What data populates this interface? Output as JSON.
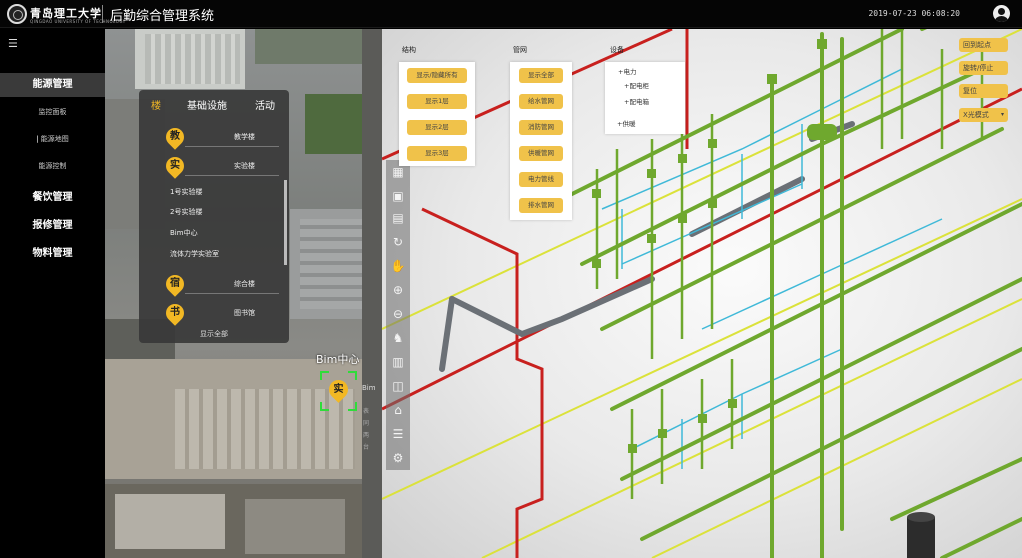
{
  "header": {
    "university_name": "青岛理工大学",
    "university_sub": "QINGDAO UNIVERSITY OF TECHNOLOGY",
    "app_title": "后勤综合管理系统",
    "datetime": "2019-07-23 06:08:20"
  },
  "sidebar": {
    "toggle_icon": "☰",
    "groups": [
      {
        "label": "能源管理",
        "active": true
      },
      {
        "label": "餐饮管理"
      },
      {
        "label": "报修管理"
      },
      {
        "label": "物料管理"
      }
    ],
    "energy_subitems": [
      "监控面板",
      "能源地图",
      "能源控制"
    ]
  },
  "map_panel": {
    "tabs": [
      "楼",
      "基础设施",
      "活动"
    ],
    "categories": [
      {
        "icon": "教",
        "label": "教学楼"
      },
      {
        "icon": "实",
        "label": "实验楼"
      },
      {
        "icon": "宿",
        "label": "综合楼"
      },
      {
        "icon": "书",
        "label": "图书馆"
      }
    ],
    "lab_items": [
      "1号实验楼",
      "2号实验楼",
      "Bim中心",
      "流体力学实验室"
    ],
    "show_all": "显示全部",
    "marker_label": "Bim中心",
    "marker_icon": "实",
    "marker_side": "Bim",
    "marker_side_lines": [
      "表",
      "同",
      "两",
      "台"
    ]
  },
  "viewer": {
    "structure": {
      "title": "结构",
      "buttons": [
        "显示/隐藏所有",
        "显示1层",
        "显示2层",
        "显示3层"
      ]
    },
    "pipes": {
      "title": "管网",
      "buttons": [
        "显示全部",
        "给水管网",
        "消防管网",
        "供暖管网",
        "电力管线",
        "排水管网"
      ]
    },
    "equipment": {
      "title": "设备",
      "tree": [
        "+电力",
        "+配电柜",
        "+配电箱",
        "+供暖"
      ]
    },
    "right_buttons": [
      "回到起点",
      "旋转/停止",
      "复位",
      "X光模式"
    ],
    "xray_caret": "▾",
    "toolbar_icons": [
      "grid-icon",
      "window-icon",
      "paste-icon",
      "rotate-icon",
      "hand-icon",
      "zoom-in-icon",
      "zoom-out-icon",
      "walk-icon",
      "ruler-icon",
      "section-icon",
      "structure-icon",
      "list-icon",
      "settings-icon"
    ]
  },
  "colors": {
    "accent_yellow": "#f2b824",
    "button_yellow": "#f0c24a",
    "pipe_green": "#6fa82e",
    "pipe_red": "#c8201e",
    "pipe_yellow": "#dbe23a",
    "pipe_cyan": "#3fb9d8",
    "marker_green": "#2fdc3a"
  }
}
